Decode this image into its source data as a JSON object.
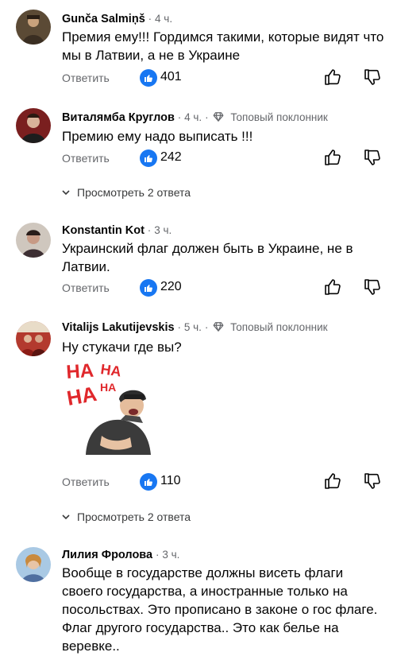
{
  "comments": [
    {
      "author": "Gunča Salmiņš",
      "time": "4 ч.",
      "badge": "",
      "text": "Премия ему!!! Гордимся такими, которые видят что мы в Латвии, а не в Украине",
      "reply_label": "Ответить",
      "likes": "401",
      "replies_link": ""
    },
    {
      "author": "Виталямба Круглов",
      "time": "4 ч.",
      "badge": "Топовый поклонник",
      "text": "Премию ему надо выписать !!!",
      "reply_label": "Ответить",
      "likes": "242",
      "replies_link": "Просмотреть 2 ответа"
    },
    {
      "author": "Konstantin Kot",
      "time": "3 ч.",
      "badge": "",
      "text": "Украинский флаг должен быть в Украине, не в Латвии.",
      "reply_label": "Ответить",
      "likes": "220",
      "replies_link": ""
    },
    {
      "author": "Vitalijs Lakutijevskis",
      "time": "5 ч.",
      "badge": "Топовый поклонник",
      "text": "Ну стукачи где вы?",
      "sticker_text": "HA HA HA HA",
      "reply_label": "Ответить",
      "likes": "110",
      "replies_link": "Просмотреть 2 ответа"
    },
    {
      "author": "Лилия Фролова",
      "time": "3 ч.",
      "badge": "",
      "text": "Вообще в государстве должны висеть флаги своего государства, а иностранные только на посольствах. Это прописано в законе о гос флаге. Флаг другого государства.. Это как белье на веревке..",
      "reply_label": "",
      "likes": "",
      "replies_link": ""
    }
  ],
  "separator": "·",
  "colors": {
    "like_blue": "#1877f2",
    "meta_gray": "#65676b",
    "text": "#050505",
    "sticker_red": "#e0282c"
  }
}
